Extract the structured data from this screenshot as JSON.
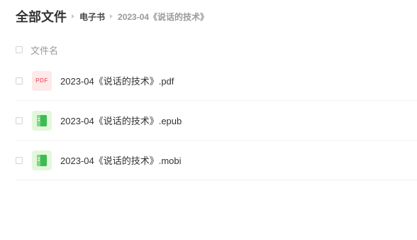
{
  "breadcrumb": {
    "root": "全部文件",
    "items": [
      "电子书"
    ],
    "current": "2023-04《说话的技术》"
  },
  "table": {
    "header_label": "文件名"
  },
  "files": [
    {
      "name": "2023-04《说话的技术》.pdf",
      "type": "pdf",
      "icon_text": "PDF",
      "icon": "pdf-file-icon"
    },
    {
      "name": "2023-04《说话的技术》.epub",
      "type": "epub",
      "icon": "ebook-icon"
    },
    {
      "name": "2023-04《说话的技术》.mobi",
      "type": "mobi",
      "icon": "ebook-icon"
    }
  ],
  "colors": {
    "pdf_icon_bg": "#fde9ea",
    "pdf_icon_text": "#f06b75",
    "ebook_icon_bg": "#e2f7dc",
    "ebook_icon_fg": "#3dbb52"
  }
}
